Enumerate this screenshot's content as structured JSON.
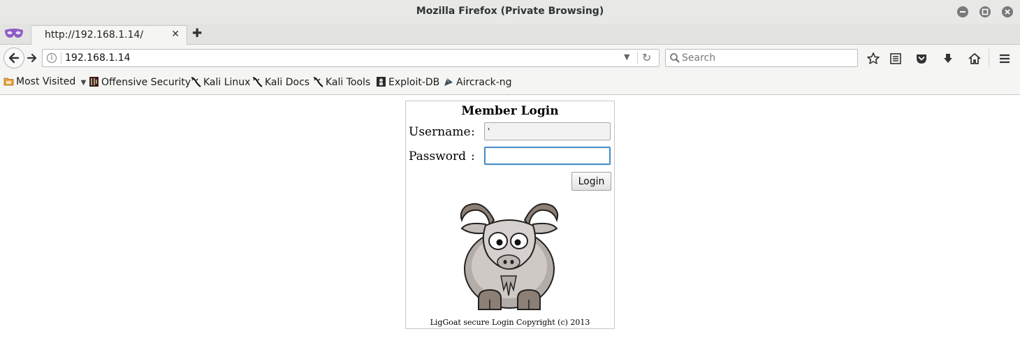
{
  "window": {
    "title": "Mozilla Firefox (Private Browsing)"
  },
  "tabs": [
    {
      "label": "http://192.168.1.14/"
    }
  ],
  "navbar": {
    "url": "192.168.1.14",
    "search_placeholder": "Search"
  },
  "bookmarks": [
    {
      "label": "Most Visited",
      "icon": "folder-icon"
    },
    {
      "label": "Offensive Security",
      "icon": "offsec-icon"
    },
    {
      "label": "Kali Linux",
      "icon": "kali-dragon-icon"
    },
    {
      "label": "Kali Docs",
      "icon": "kali-dragon-icon"
    },
    {
      "label": "Kali Tools",
      "icon": "kali-dragon-icon"
    },
    {
      "label": "Exploit-DB",
      "icon": "exploitdb-icon"
    },
    {
      "label": "Aircrack-ng",
      "icon": "aircrack-icon"
    }
  ],
  "login": {
    "title": "Member Login",
    "username_label": "Username",
    "password_label": "Password",
    "colon": ":",
    "username_value": "'",
    "password_value": "",
    "button_label": "Login",
    "copyright": "LigGoat secure Login Copyright (c) 2013"
  },
  "colors": {
    "focus_ring": "#4a90c8",
    "titlebar_bg": "#e8e8e7"
  }
}
